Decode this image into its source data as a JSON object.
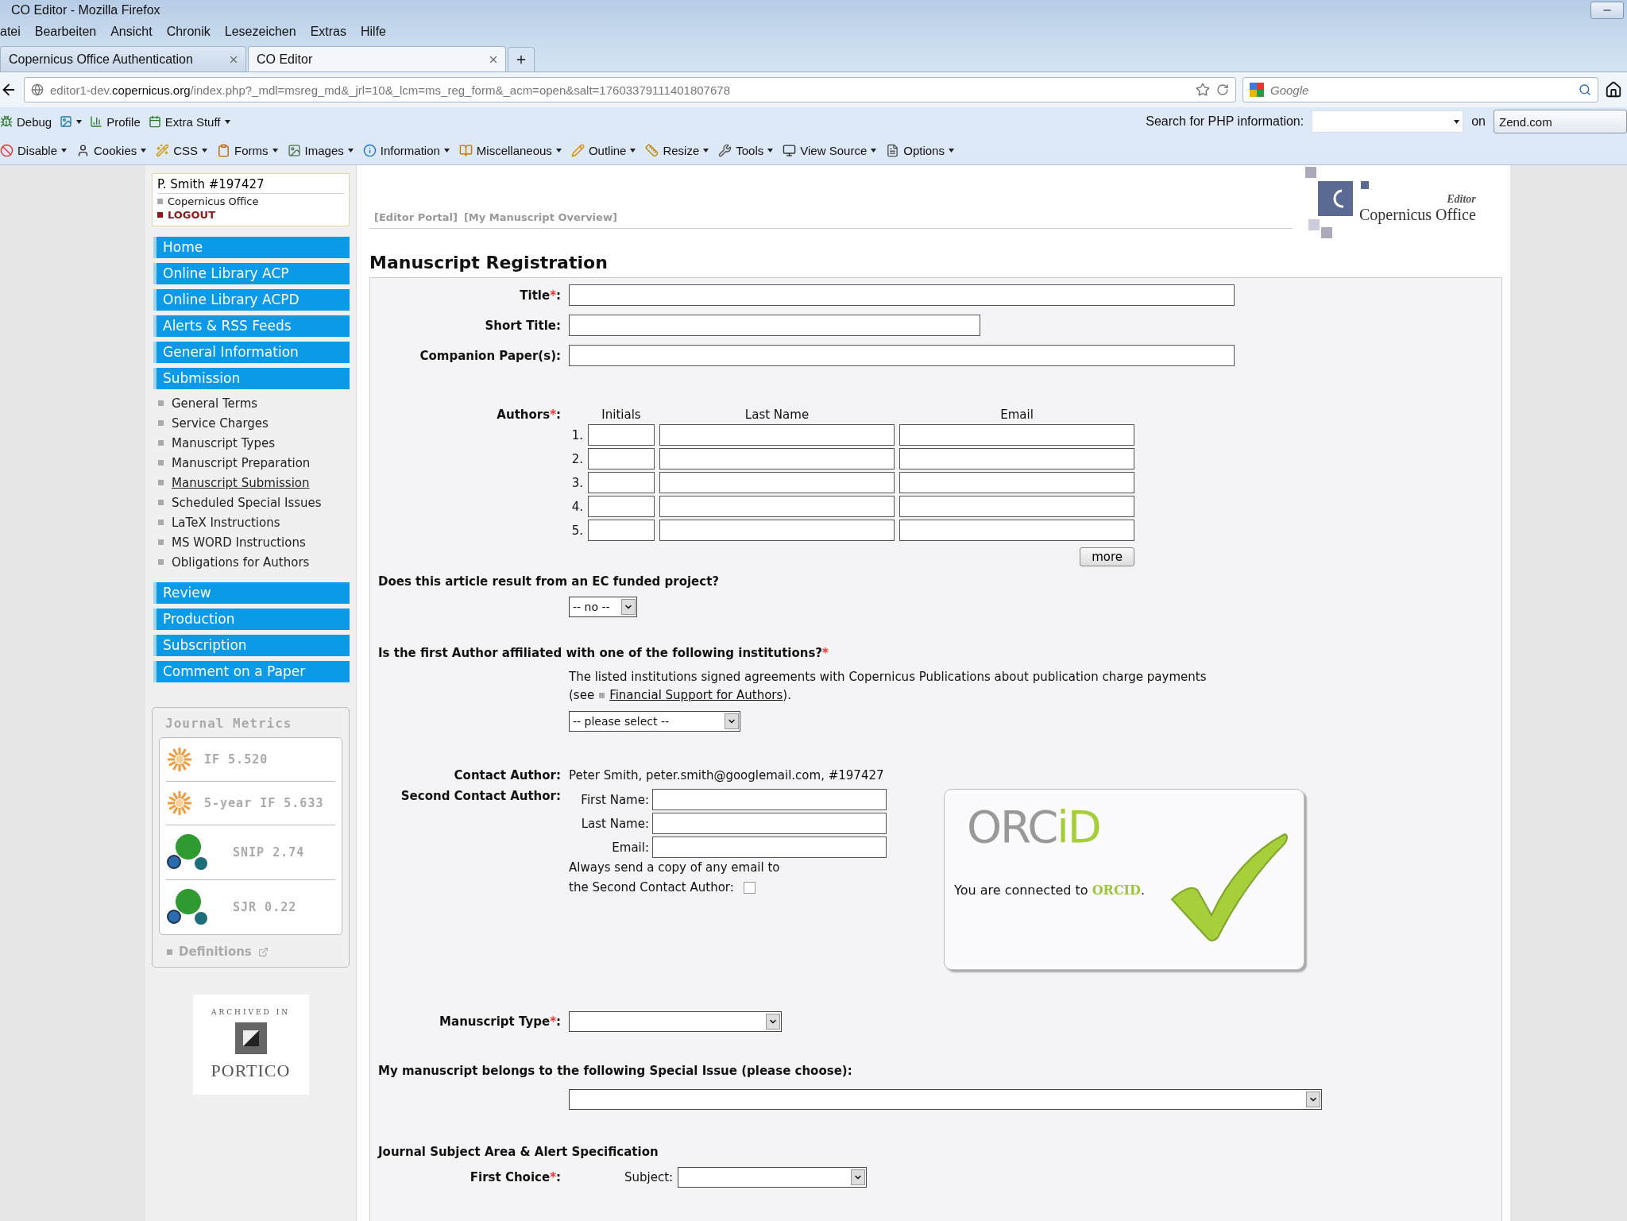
{
  "window": {
    "title": "CO Editor - Mozilla Firefox"
  },
  "menu": [
    "atei",
    "Bearbeiten",
    "Ansicht",
    "Chronik",
    "Lesezeichen",
    "Extras",
    "Hilfe"
  ],
  "tabs": [
    {
      "label": "Copernicus Office Authentication",
      "selected": false
    },
    {
      "label": "CO Editor",
      "selected": true
    }
  ],
  "address": {
    "url": "editor1-dev.**copernicus.org**/index.php?_mdl=msreg_md&_jrl=10&_lcm=ms_reg_form&_acm=open&salt=17603379111401807678"
  },
  "search": {
    "placeholder": "Google"
  },
  "developer_bar": {
    "items": [
      "Debug",
      "Profile",
      "Extra Stuff"
    ],
    "php_search_label": "Search for PHP information:",
    "on_label": "on",
    "site": "Zend.com"
  },
  "toolbar": [
    "Disable",
    "Cookies",
    "CSS",
    "Forms",
    "Images",
    "Information",
    "Miscellaneous",
    "Outline",
    "Resize",
    "Tools",
    "View Source",
    "Options"
  ],
  "sidebar": {
    "user": "P. Smith #197427",
    "links": [
      "Copernicus Office",
      "LOGOUT"
    ],
    "nav": [
      {
        "label": "Home"
      },
      {
        "label": "Online Library ACP"
      },
      {
        "label": "Online Library ACPD"
      },
      {
        "label": "Alerts & RSS Feeds"
      },
      {
        "label": "General Information"
      },
      {
        "label": "Submission",
        "children": [
          {
            "label": "General Terms",
            "selected": false
          },
          {
            "label": "Service Charges",
            "selected": false
          },
          {
            "label": "Manuscript Types",
            "selected": false
          },
          {
            "label": "Manuscript Preparation",
            "selected": false
          },
          {
            "label": "Manuscript Submission",
            "selected": true
          },
          {
            "label": "Scheduled Special Issues",
            "selected": false
          },
          {
            "label": "LaTeX Instructions",
            "selected": false
          },
          {
            "label": "MS WORD Instructions",
            "selected": false
          },
          {
            "label": "Obligations for Authors",
            "selected": false
          }
        ]
      },
      {
        "label": "Review"
      },
      {
        "label": "Production"
      },
      {
        "label": "Subscription"
      },
      {
        "label": "Comment on a Paper"
      }
    ],
    "metrics": {
      "title": "Journal Metrics",
      "items": [
        {
          "label": "IF 5.520",
          "kind": "impact"
        },
        {
          "label": "5-year IF 5.633",
          "kind": "impact"
        },
        {
          "label": "SNIP 2.74",
          "kind": "scimago"
        },
        {
          "label": "SJR 0.22",
          "kind": "scimago"
        }
      ],
      "definitions": "Definitions"
    },
    "archive": {
      "caption": "ARCHIVED IN",
      "name": "PORTICO"
    }
  },
  "main": {
    "breadcrumbs": [
      "[Editor Portal]",
      "[My Manuscript Overview]"
    ],
    "logo": {
      "tag": "Editor",
      "name": "Copernicus Office"
    },
    "heading": "Manuscript Registration",
    "text_fields": [
      {
        "label": "Title",
        "mark": "*",
        "tail": ":"
      },
      {
        "label": "Short Title:"
      },
      {
        "label": "Companion Paper(s):"
      }
    ],
    "authors": {
      "label": "Authors",
      "mark": "*",
      "tail": ":",
      "columns": [
        "Initials",
        "Last Name",
        "Email"
      ],
      "rows": [
        "1.",
        "2.",
        "3.",
        "4.",
        "5."
      ],
      "more": "more"
    },
    "ec_project": {
      "question": "Does this article result from an EC funded project?",
      "value": "-- no --"
    },
    "affiliation": {
      "question": "Is the first Author affiliated with one of the following institutions?",
      "mark": "*",
      "note": "The listed institutions signed agreements with Copernicus Publications about publication charge payments",
      "see": "(see",
      "link": "Financial Support for Authors",
      "after": ").",
      "value": "-- please select --"
    },
    "contact": {
      "label": "Contact Author:",
      "value": "Peter Smith, peter.smith@googlemail.com, #197427"
    },
    "second_contact": {
      "label": "Second Contact Author:",
      "fields": [
        "First Name:",
        "Last Name:",
        "Email:"
      ],
      "copy_note": [
        "Always send a copy of any email to",
        "the Second Contact Author:"
      ],
      "checked": false
    },
    "orcid": {
      "logo": [
        "ORC",
        "iD"
      ],
      "message": "You are connected to **ORCID**."
    },
    "manuscript_type": {
      "label": "Manuscript Type",
      "mark": "*",
      "tail": ":"
    },
    "special_issue": {
      "question": "My manuscript belongs to the following Special Issue (please choose):"
    },
    "subject_area": {
      "heading": "Journal Subject Area & Alert Specification",
      "label": "First Choice",
      "mark": "*",
      "tail": ":",
      "subject": "Subject:"
    }
  }
}
